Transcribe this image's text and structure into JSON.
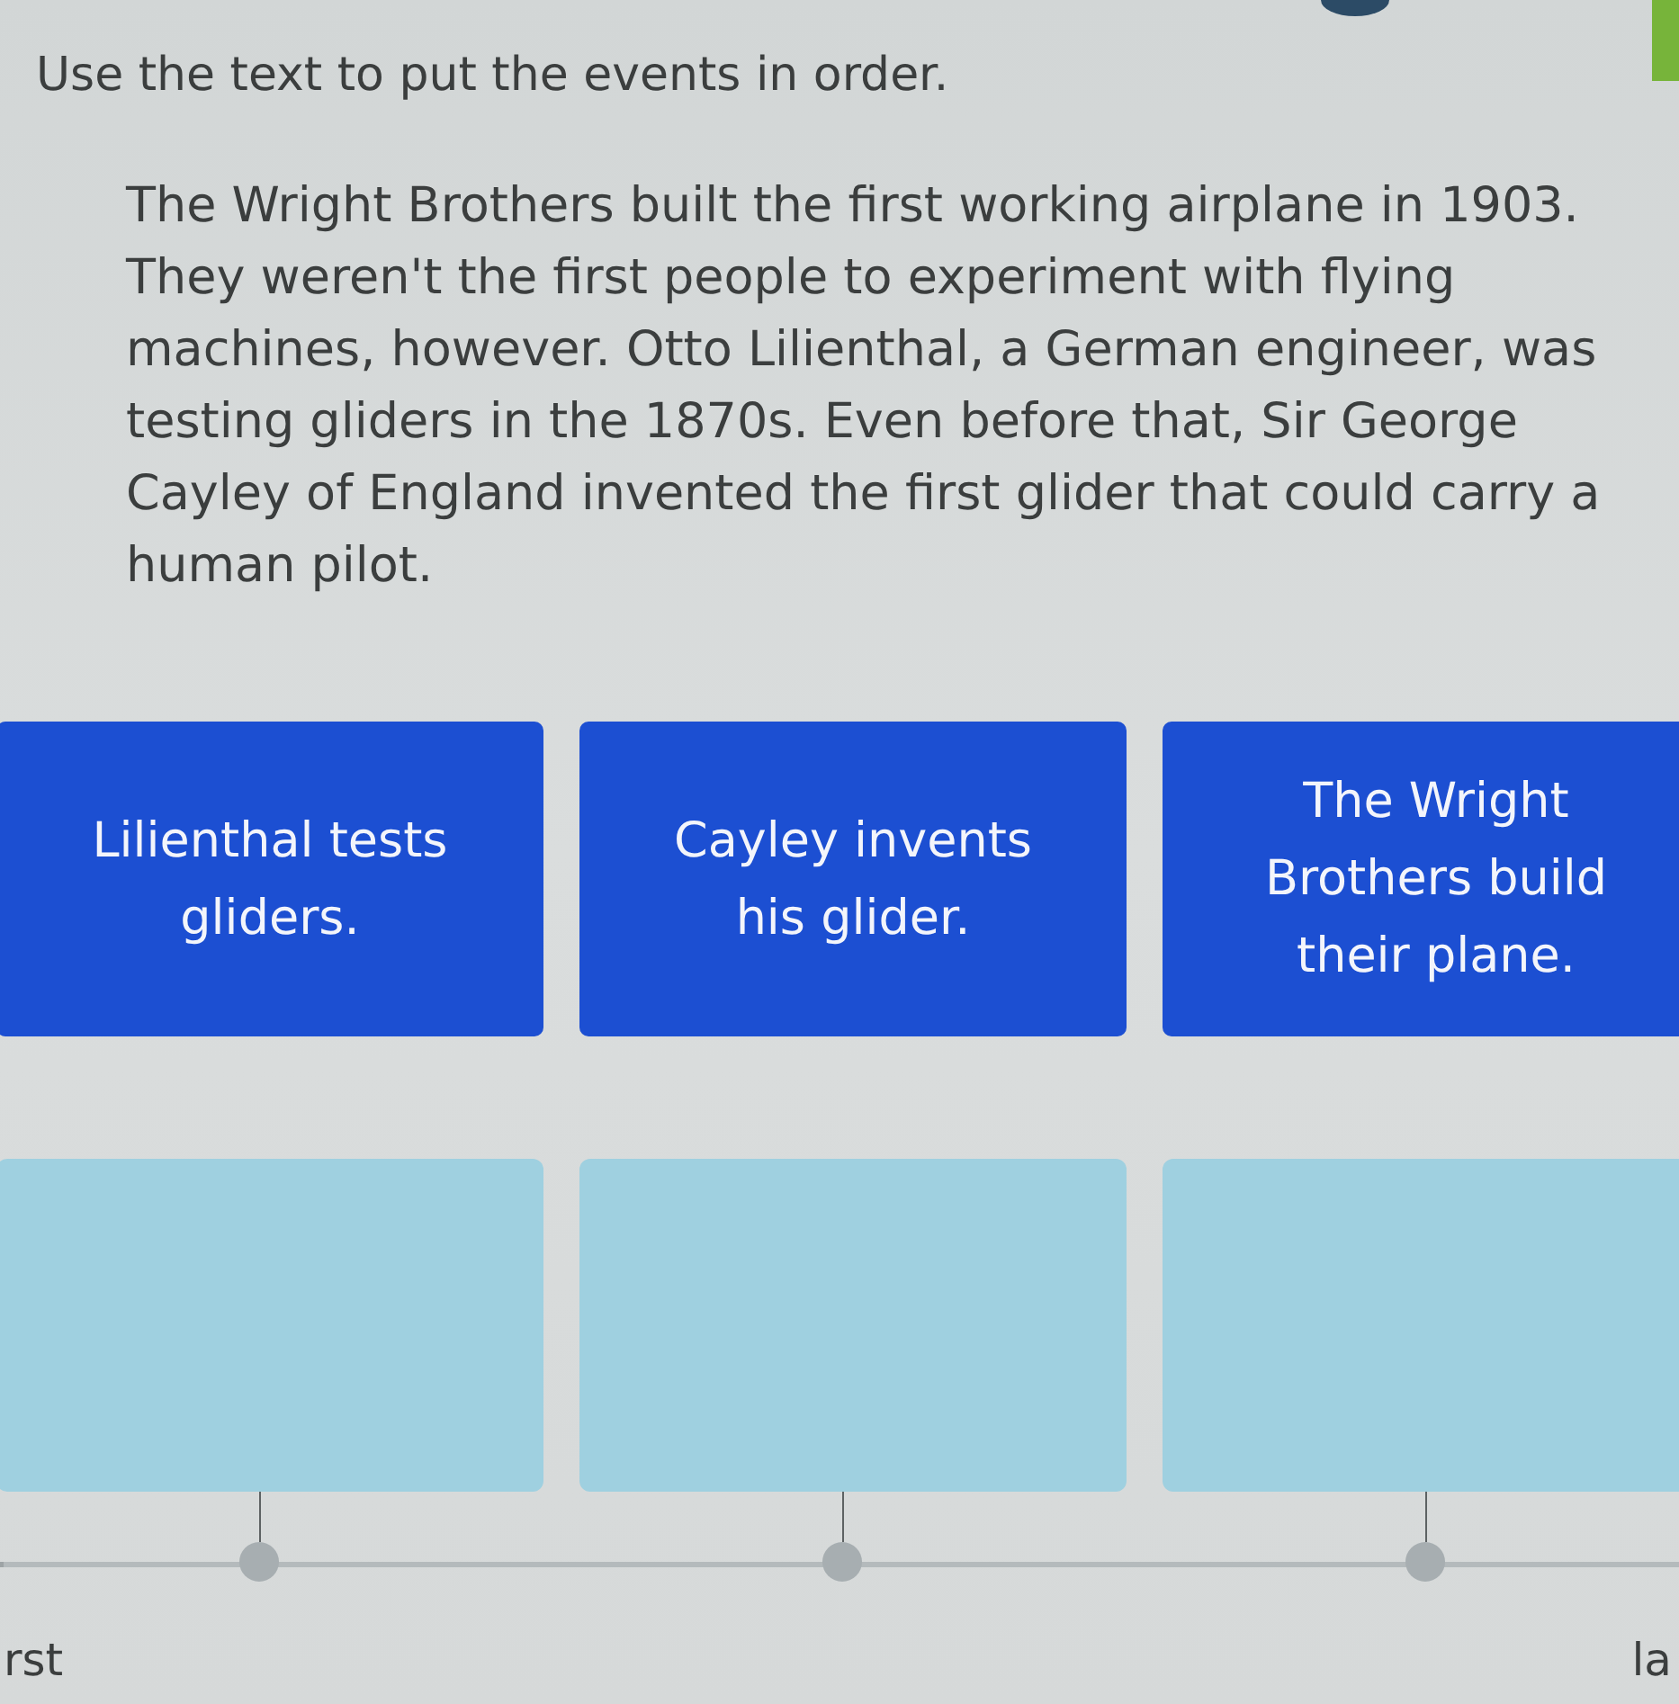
{
  "prompt": "Use the text to put the events in order.",
  "passage": "The Wright Brothers built the first working airplane in 1903. They weren't the first people to experiment with flying machines, however. Otto Lilienthal, a German engineer, was testing gliders in the 1870s. Even before that, Sir George Cayley of England invented the first glider that could carry a human pilot.",
  "event_cards": [
    {
      "text": "Lilienthal tests gliders."
    },
    {
      "text": "Cayley invents his glider."
    },
    {
      "text": "The Wright Brothers build their plane."
    }
  ],
  "timeline": {
    "start_label": "rst",
    "end_label": "la"
  }
}
